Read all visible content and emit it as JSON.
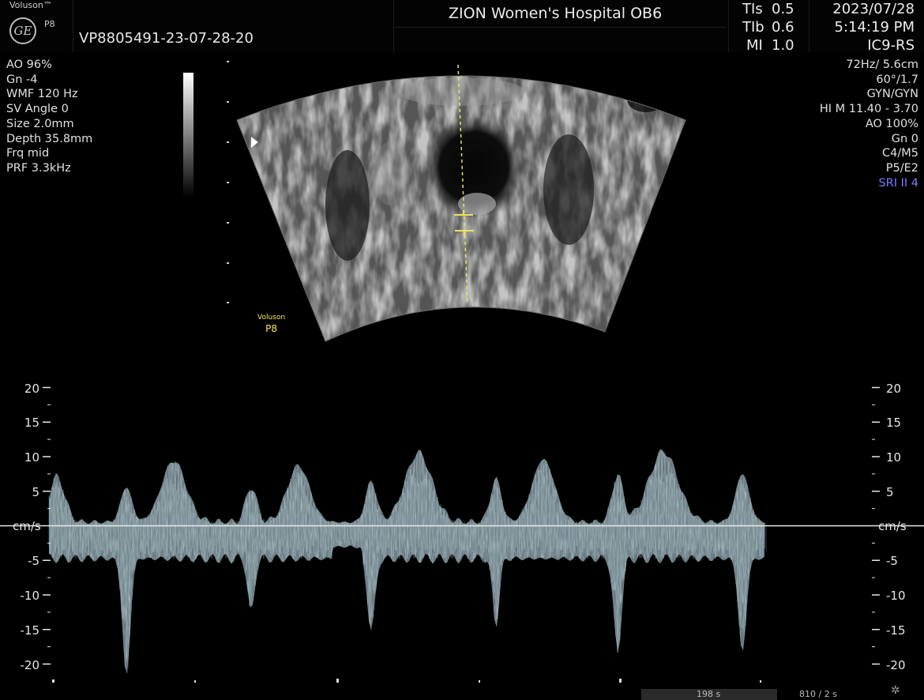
{
  "header": {
    "brand": "Voluson™",
    "probe_small": "P8",
    "logo_text": "GE",
    "patient_id": "VP8805491-23-07-28-20",
    "hospital": "ZION Women's Hospital OB6",
    "safety": [
      {
        "label": "TIs",
        "value": "0.5"
      },
      {
        "label": "TIb",
        "value": "0.6"
      },
      {
        "label": "MI",
        "value": "1.0"
      }
    ],
    "date": "2023/07/28",
    "time": "5:14:19 PM",
    "transducer": "IC9-RS"
  },
  "left_params": [
    "AO 96%",
    "Gn  -4",
    "WMF 120 Hz",
    "SV Angle  0",
    "Size  2.0mm",
    "Depth 35.8mm",
    "Frq mid",
    "PRF  3.3kHz"
  ],
  "right_params": [
    "72Hz/ 5.6cm",
    "60°/1.7",
    "GYN/GYN",
    "HI M  11.40 - 3.70",
    "AO 100%",
    "Gn   0",
    "C4/M5",
    "P5/E2"
  ],
  "right_params_highlight": "SRI II 4",
  "image_logo": {
    "brand": "Voluson",
    "probe": "P8"
  },
  "doppler": {
    "unit": "cm/s",
    "left_ticks": [
      "20",
      "15",
      "10",
      "5",
      "-5",
      "-10",
      "-15",
      "-20"
    ],
    "right_ticks": [
      "20",
      "15",
      "10",
      "5",
      "-5",
      "-10",
      "-15",
      "-20"
    ],
    "scale_values": [
      20,
      15,
      10,
      5,
      -5,
      -10,
      -15,
      -20
    ]
  },
  "bottom": {
    "time_label_1": "198 s",
    "time_label_2": "810 / 2 s"
  },
  "colors": {
    "spectrum": "#b8d6e0",
    "caliper": "#e6e65a",
    "sri": "#7b7bff"
  }
}
